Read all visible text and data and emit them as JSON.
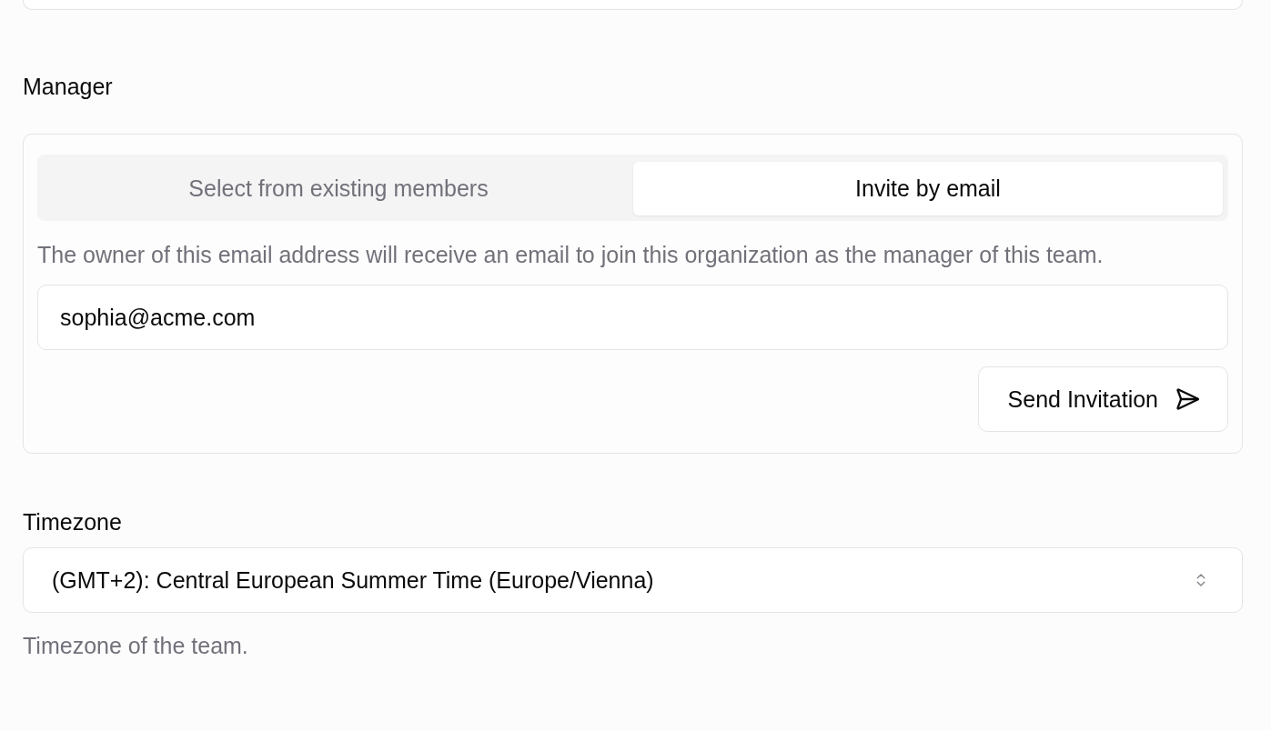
{
  "manager": {
    "label": "Manager",
    "tabs": [
      {
        "label": "Select from existing members",
        "selected": false
      },
      {
        "label": "Invite by email",
        "selected": true
      }
    ],
    "description": "The owner of this email address will receive an email to join this organization as the manager of this team.",
    "email_field": {
      "value": "sophia@acme.com"
    },
    "send_button": "Send Invitation"
  },
  "timezone": {
    "label": "Timezone",
    "select": {
      "value": "(GMT+2): Central European Summer Time (Europe/Vienna)"
    },
    "hint": "Timezone of the team."
  }
}
